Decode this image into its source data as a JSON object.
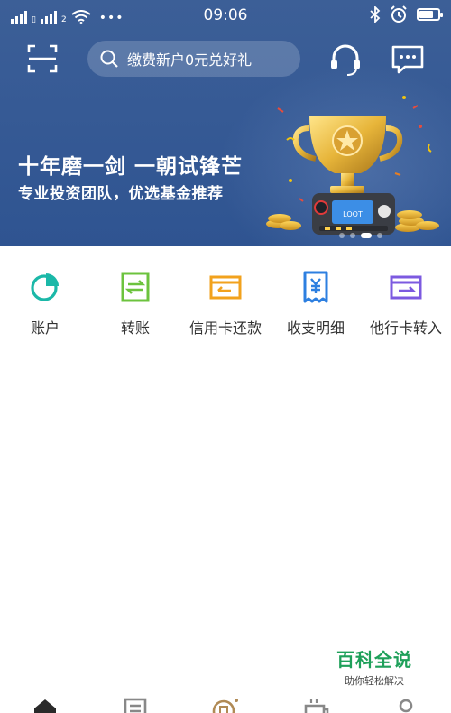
{
  "status_bar": {
    "carrier_tag": "2",
    "menu_dots": "•••",
    "time": "09:06"
  },
  "search": {
    "placeholder": "缴费新户0元兑好礼"
  },
  "banner": {
    "title": "十年磨一剑  一朝试锋芒",
    "subtitle": "专业投资团队，优选基金推荐",
    "active_slide": 3,
    "slide_count": 4
  },
  "quick_actions": [
    {
      "label": "账户",
      "icon": "pie-chart-icon",
      "color": "#1bb8a8"
    },
    {
      "label": "转账",
      "icon": "transfer-icon",
      "color": "#6cc33e"
    },
    {
      "label": "信用卡还款",
      "icon": "credit-card-icon",
      "color": "#f2a21d"
    },
    {
      "label": "收支明细",
      "icon": "receipt-icon",
      "color": "#2d7fe0"
    },
    {
      "label": "他行卡转入",
      "icon": "card-in-icon",
      "color": "#7c5ae0"
    }
  ],
  "watermark": {
    "title": "百科全说",
    "subtitle": "助你轻松解决"
  },
  "tab_bar": {
    "icons": [
      "home-icon",
      "list-icon",
      "wealth-icon",
      "mall-icon",
      "profile-icon"
    ]
  }
}
